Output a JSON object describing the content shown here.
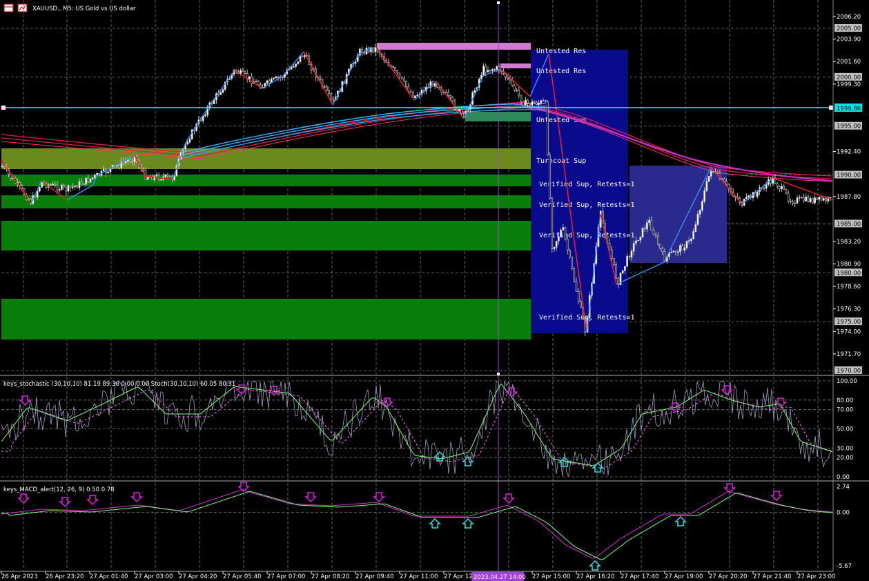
{
  "window": {
    "title": "XAUUSD., M5: US Gold vs US dollar",
    "icon_names": [
      "chart-window-icon",
      "indicator-icon"
    ]
  },
  "colors": {
    "background": "#000000",
    "grid": "#8a8a8a",
    "bull_candle": "#ffffff",
    "bear_candle": "#ffffff",
    "zigzag_up": "#3a8eff",
    "zigzag_down": "#ff2020",
    "ma_red": "#d8204a",
    "ma_magenta": "#d32fd3",
    "ma_cyan": "#3ab4ff",
    "hline": "#00ffff",
    "res_zone": "#d07ad0",
    "sup_zone": "#0a7d0a",
    "olive_zone": "#6b8a1e",
    "teal_zone": "#2e8a5a",
    "box_blue": "#0a0a8c",
    "box_slate": "#2a2a8c",
    "vline": "#a040e0",
    "stoch_main": "#a0a0c0",
    "stoch_signal": "#7fff7f",
    "stoch_dash": "#ff77ff",
    "macd_line": "#d32fd3",
    "macd_signal": "#7fff7f",
    "arrow_down": "#e020e0",
    "arrow_up": "#30e0e0"
  },
  "zone_labels": [
    "Untested Res",
    "Untested Res",
    "Untested Sup",
    "Turncoat Sup",
    "Verified Sup, Retests=1",
    "Verified Sup, Retests=1",
    "Verified Sup, Retests=1",
    "Verified Sup, Retests=1"
  ],
  "price_axis": {
    "ticks": [
      "2006.20",
      "2003.90",
      "2001.60",
      "1999.30",
      "1992.40",
      "1987.80",
      "1983.20",
      "1980.90",
      "1978.60",
      "1976.30",
      "1974.00",
      "1971.70"
    ],
    "boxed": [
      "2005.00",
      "2000.00",
      "1995.00",
      "1990.00",
      "1985.00",
      "1980.00",
      "1975.00",
      "1970.00"
    ],
    "current_price": "1996.86"
  },
  "time_axis": {
    "labels": [
      "26 Apr 2023",
      "26 Apr 23:20",
      "27 Apr 01:40",
      "27 Apr 03:00",
      "27 Apr 04:20",
      "27 Apr 05:40",
      "27 Apr 07:00",
      "27 Apr 08:20",
      "27 Apr 09:40",
      "27 Apr 11:00",
      "27 Apr 12",
      "27 Apr 15:00",
      "27 Apr 16:20",
      "27 Apr 17:40",
      "27 Apr 19:00",
      "27 Apr 20:20",
      "27 Apr 21:40",
      "27 Apr 23:00"
    ],
    "highlight": "2023.04.27 14:00"
  },
  "stochastic": {
    "label": "keys_stochastic (30,10,10) 81.19 89.30 0.00 0.00 Stoch(30,10,10) 60.05 80.31",
    "levels": [
      "100.00",
      "80.00",
      "70.00",
      "50.00",
      "30.00",
      "20.00",
      "0.00"
    ]
  },
  "macd": {
    "label": "keys_MACD_alert(12, 26, 9) 0.50 0.78",
    "levels": [
      "2.74",
      "0.00",
      "-5.67"
    ]
  },
  "chart_data": {
    "type": "line",
    "symbol": "XAUUSD.",
    "timeframe": "M5",
    "ylim": [
      1970.0,
      2007.0
    ],
    "price_path": {
      "x": [
        "26 Apr 2023",
        "26 Apr 23:20",
        "27 Apr 01:40",
        "27 Apr 03:00",
        "27 Apr 04:20",
        "27 Apr 05:40",
        "27 Apr 07:00",
        "27 Apr 08:20",
        "27 Apr 09:40",
        "27 Apr 11:00",
        "27 Apr 12",
        "27 Apr 15:00",
        "27 Apr 16:20",
        "27 Apr 17:40",
        "27 Apr 19:00",
        "27 Apr 20:20",
        "27 Apr 21:40",
        "27 Apr 23:00"
      ],
      "y": [
        1991.0,
        1988.5,
        1990.0,
        1991.8,
        1994.5,
        2001.0,
        1999.5,
        2002.3,
        2001.5,
        1998.8,
        2000.8,
        1996.0,
        1974.5,
        1984.0,
        1982.0,
        1990.5,
        1989.5,
        1988.0
      ]
    },
    "stochastic_ylim": [
      0,
      100
    ],
    "macd_ylim": [
      -5.67,
      2.74
    ]
  }
}
